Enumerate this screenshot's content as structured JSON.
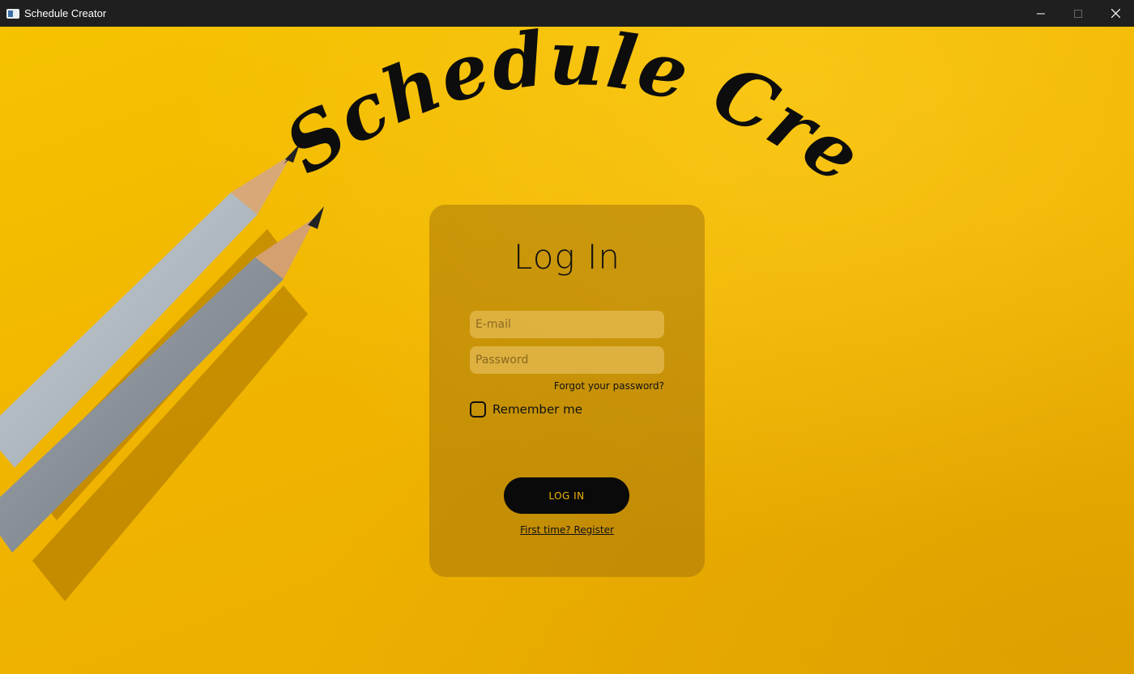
{
  "window": {
    "title": "Schedule Creator",
    "controls": [
      "minimize-icon",
      "maximize-icon",
      "close-icon"
    ]
  },
  "brand": {
    "title": "Schedule Creator"
  },
  "login": {
    "heading": "Log In",
    "email_placeholder": "E-mail",
    "email_value": "",
    "password_placeholder": "Password",
    "password_value": "",
    "forgot_label": "Forgot your password?",
    "remember_label": "Remember me",
    "remember_checked": false,
    "submit_label": "LOG IN",
    "register_label": "First time? Register"
  },
  "colors": {
    "background": "#f1b400",
    "titlebar": "#1f1f1f",
    "button_bg": "#0a0a0a",
    "button_text": "#f1b400",
    "text": "#111111"
  }
}
